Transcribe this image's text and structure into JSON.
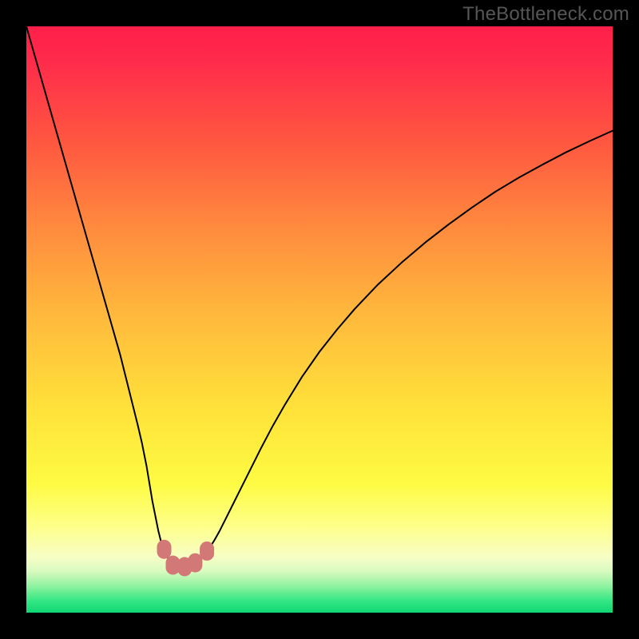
{
  "watermark": "TheBottleneck.com",
  "chart_data": {
    "type": "line",
    "title": "",
    "xlabel": "",
    "ylabel": "",
    "xlim": [
      0,
      100
    ],
    "ylim": [
      0,
      100
    ],
    "series": [
      {
        "name": "curve",
        "x": [
          0,
          2,
          4,
          6,
          8,
          10,
          12,
          14,
          16,
          17,
          18,
          19,
          19.7,
          20.5,
          21,
          21.5,
          22,
          22.5,
          23,
          23.3,
          23.7,
          24.2,
          24.7,
          25.2,
          25.8,
          26.3,
          26.9,
          27.6,
          28.2,
          28.9,
          29.5,
          30.1,
          30.7,
          31.2,
          31.6,
          32.1,
          33.0,
          34.0,
          35.0,
          36.5,
          38.0,
          40.0,
          42.0,
          44.0,
          47.0,
          50.0,
          53.0,
          56.0,
          60.0,
          64.0,
          68.0,
          72.0,
          76.0,
          80.0,
          84.0,
          88.0,
          92.0,
          96.0,
          100.0
        ],
        "y": [
          100,
          93,
          86,
          79,
          72,
          65,
          58,
          51,
          44,
          40,
          36,
          32,
          29,
          25,
          22,
          19,
          16.5,
          14,
          12,
          11,
          10,
          9.2,
          8.6,
          8.2,
          7.9,
          7.8,
          7.85,
          8.0,
          8.3,
          8.7,
          9.2,
          9.8,
          10.4,
          11.0,
          11.6,
          12.4,
          14.0,
          16.0,
          18.0,
          21.0,
          24.0,
          28.0,
          31.8,
          35.3,
          40.2,
          44.5,
          48.3,
          51.8,
          56.0,
          59.7,
          63.1,
          66.2,
          69.1,
          71.8,
          74.2,
          76.4,
          78.5,
          80.4,
          82.2
        ]
      }
    ],
    "markers": [
      {
        "x": 23.5,
        "y": 10.8
      },
      {
        "x": 25.0,
        "y": 8.1
      },
      {
        "x": 27.0,
        "y": 7.85
      },
      {
        "x": 28.8,
        "y": 8.5
      },
      {
        "x": 30.8,
        "y": 10.5
      }
    ],
    "gradient_stops": [
      {
        "offset": 0.0,
        "color": "#ff1f4a"
      },
      {
        "offset": 0.06,
        "color": "#ff2b4b"
      },
      {
        "offset": 0.2,
        "color": "#ff5840"
      },
      {
        "offset": 0.35,
        "color": "#ff8d3e"
      },
      {
        "offset": 0.5,
        "color": "#ffbb3c"
      },
      {
        "offset": 0.65,
        "color": "#ffe13a"
      },
      {
        "offset": 0.78,
        "color": "#fefb43"
      },
      {
        "offset": 0.85,
        "color": "#feff86"
      },
      {
        "offset": 0.905,
        "color": "#f7fec5"
      },
      {
        "offset": 0.93,
        "color": "#d7fac0"
      },
      {
        "offset": 0.955,
        "color": "#8ef2a0"
      },
      {
        "offset": 0.98,
        "color": "#33e683"
      },
      {
        "offset": 1.0,
        "color": "#0fd873"
      }
    ],
    "marker_color": "#d27876",
    "curve_color": "#000000"
  }
}
